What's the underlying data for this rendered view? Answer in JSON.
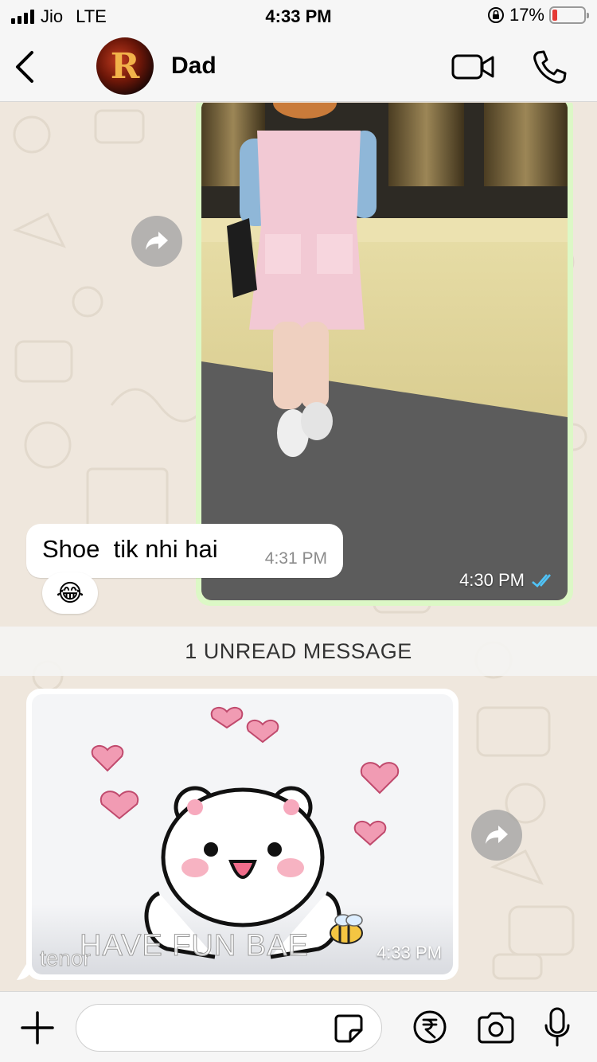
{
  "status_bar": {
    "carrier": "Jio",
    "network": "LTE",
    "time": "4:33 PM",
    "battery_percent": "17%",
    "battery_level": 0.17,
    "battery_color": "#e53935"
  },
  "header": {
    "contact_name": "Dad",
    "avatar_letter": "R",
    "icons": {
      "back": "chevron-left-icon",
      "video": "video-camera-icon",
      "call": "phone-icon"
    }
  },
  "messages": {
    "outgoing_image": {
      "time": "4:30 PM",
      "status": "read",
      "status_color": "#4fc3f7"
    },
    "incoming_text": {
      "text": "Shoe  tik nhi hai",
      "time": "4:31 PM",
      "reaction": "😂"
    },
    "unread_banner": "1 UNREAD MESSAGE",
    "incoming_gif": {
      "caption": "HAVE FUN BAE",
      "source": "tenor",
      "time": "4:33 PM"
    }
  },
  "input_bar": {
    "placeholder": "",
    "icons": {
      "plus": "plus-icon",
      "sticker": "sticker-icon",
      "payment": "rupee-icon",
      "camera": "camera-icon",
      "mic": "microphone-icon"
    }
  },
  "colors": {
    "outgoing_bubble": "#dcf8c6",
    "incoming_bubble": "#ffffff",
    "chat_background": "#efe7dd"
  }
}
